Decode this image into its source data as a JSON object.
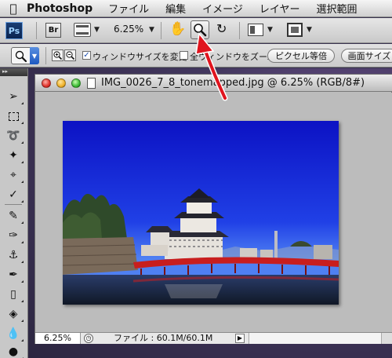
{
  "menubar": {
    "apple_icon": "apple-logo-icon",
    "app_name": "Photoshop",
    "items": [
      "ファイル",
      "編集",
      "イメージ",
      "レイヤー",
      "選択範囲"
    ]
  },
  "appbar": {
    "ps_label": "Ps",
    "br_label": "Br",
    "zoom_level": "6.25%",
    "dropdown_glyph": "▼"
  },
  "options": {
    "resize_windows_label": "ウィンドウサイズを変更",
    "resize_windows_checked": true,
    "zoom_all_label": "全ウィンドウをズーム",
    "zoom_all_checked": false,
    "actual_pixels_label": "ピクセル等倍",
    "fit_screen_label": "画面サイズ"
  },
  "document": {
    "title": "IMG_0026_7_8_tonemapped.jpg @ 6.25% (RGB/8#)",
    "status_zoom": "6.25%",
    "status_info": "ファイル : 60.1M/60.1M"
  },
  "colors": {
    "annotation_arrow": "#e0141e",
    "photo_sky_top": "#1218c8",
    "photo_sky_bottom": "#4a7af0",
    "bridge": "#c81e1e"
  }
}
